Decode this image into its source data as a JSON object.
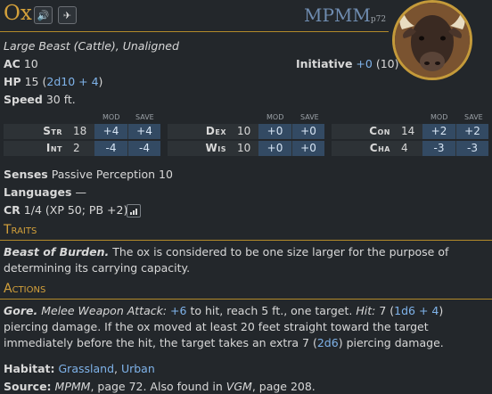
{
  "header": {
    "name": "Ox",
    "source_abbr": "MPMM",
    "source_page": "p72",
    "speak_button_label": "🔊",
    "share_button_label": "✈"
  },
  "meta": {
    "type_line": "Large Beast (Cattle), Unaligned",
    "ac_label": "AC",
    "ac_value": "10",
    "initiative_label": "Initiative",
    "initiative_mod": "+0",
    "initiative_score": "(10)",
    "hp_label": "HP",
    "hp_value": "15",
    "hp_formula": "2d10 + 4",
    "speed_label": "Speed",
    "speed_value": "30 ft."
  },
  "abilities": {
    "mod_header": "MOD",
    "save_header": "SAVE",
    "items": [
      {
        "name": "Str",
        "score": "18",
        "mod": "+4",
        "save": "+4"
      },
      {
        "name": "Int",
        "score": "2",
        "mod": "-4",
        "save": "-4"
      },
      {
        "name": "Dex",
        "score": "10",
        "mod": "+0",
        "save": "+0"
      },
      {
        "name": "Wis",
        "score": "10",
        "mod": "+0",
        "save": "+0"
      },
      {
        "name": "Con",
        "score": "14",
        "mod": "+2",
        "save": "+2"
      },
      {
        "name": "Cha",
        "score": "4",
        "mod": "-3",
        "save": "-3"
      }
    ]
  },
  "details": {
    "senses_label": "Senses",
    "senses_value": "Passive Perception 10",
    "languages_label": "Languages",
    "languages_value": "—",
    "cr_label": "CR",
    "cr_value": "1/4 (XP 50; PB +2)"
  },
  "traits": {
    "heading": "Traits",
    "items": [
      {
        "name": "Beast of Burden.",
        "text": "The ox is considered to be one size larger for the purpose of determining its carrying capacity."
      }
    ]
  },
  "actions": {
    "heading": "Actions",
    "gore": {
      "name": "Gore.",
      "attack_type": "Melee Weapon Attack:",
      "to_hit": "+6",
      "after_hit": "to hit, reach 5 ft., one target.",
      "hit_label": "Hit:",
      "hit_avg": "7",
      "hit_roll": "1d6 + 4",
      "hit_rest": "piercing damage. If the ox moved at least 20 feet straight toward the target immediately before the hit, the target takes an extra 7",
      "extra_roll": "2d6",
      "extra_rest": "piercing damage."
    }
  },
  "footer": {
    "habitat_label": "Habitat:",
    "habitats": [
      "Grassland",
      "Urban"
    ],
    "source_label": "Source:",
    "source_book": "MPMM",
    "source_text": ", page 72. Also found in",
    "also_book": "VGM",
    "also_text": ", page 208."
  },
  "colors": {
    "gold": "#d4a13b",
    "roll_blue": "#7fb3ea",
    "background": "#23272b",
    "mod_cell": "#334a63"
  }
}
